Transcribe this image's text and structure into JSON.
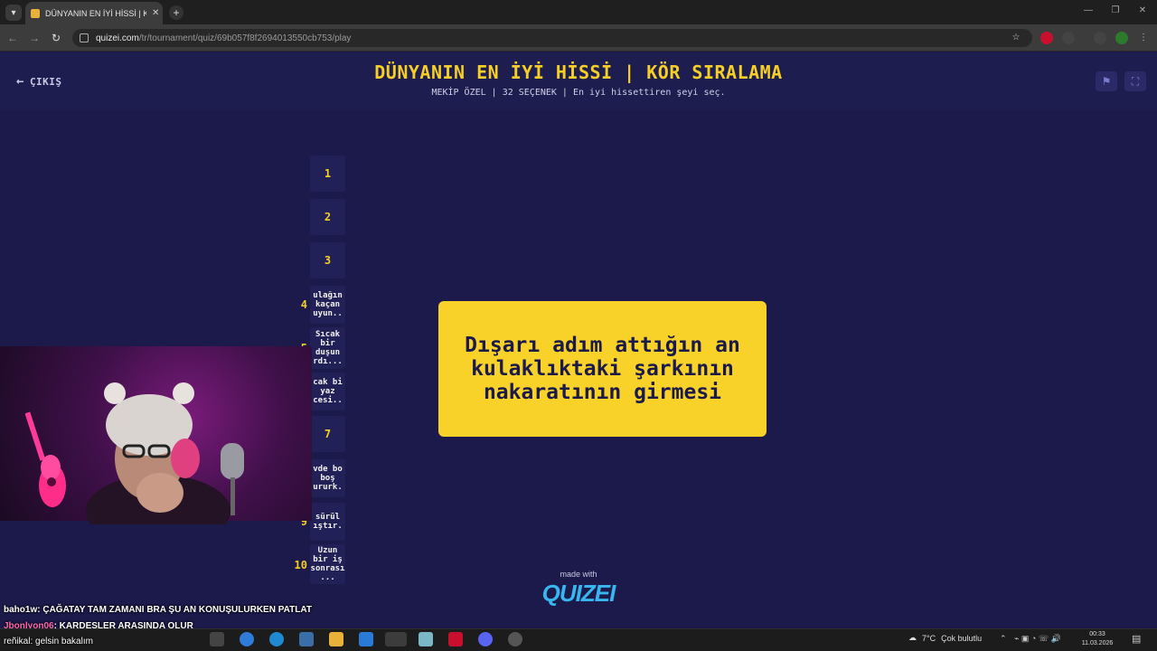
{
  "browser": {
    "tab_title": "DÜNYANIN EN İYİ HİSSİ | KÖR S",
    "url_domain": "quizei.com",
    "url_path": "/tr/tournament/quiz/69b057f8f2694013550cb753/play"
  },
  "header": {
    "exit_label": "ÇIKIŞ",
    "title": "DÜNYANIN EN İYİ HİSSİ | KÖR SIRALAMA",
    "subtitle": "MEKİP ÖZEL | 32 SEÇENEK | En iyi hissettiren şeyi seç."
  },
  "ranking": {
    "slots": [
      {
        "label": "1"
      },
      {
        "label": "2"
      },
      {
        "label": "3"
      },
      {
        "rank": "4",
        "text": "ulağın\nkaçan\nuyun.."
      },
      {
        "rank": "5",
        "text": "Sıcak\nbir\nduşun\nrdı..."
      },
      {
        "rank": "6",
        "text": "cak bi\nyaz\ncesi.."
      },
      {
        "label": "7"
      },
      {
        "rank": "8",
        "text": "vde bo\nboş\nururk."
      },
      {
        "rank": "9",
        "text": "sürül\nıştır."
      },
      {
        "rank": "10",
        "text": "Uzun\nbir iş\nsonrası\n..."
      }
    ]
  },
  "card": {
    "text": "Dışarı adım attığın an kulaklıktaki şarkının nakaratının girmesi"
  },
  "footer": {
    "made_with": "made with",
    "logo": "QUIZEI"
  },
  "chat": {
    "lines": [
      {
        "user": "baho1w",
        "message": ": ÇAĞATAY TAM ZAMANI BRA ŞU AN KONUŞULURKEN PATLAT"
      },
      {
        "user": "Jbonlyon06",
        "message": ": KARDEŞLER ARASINDA OLUR"
      },
      {
        "user": "reñikal",
        "message": ": gelsin bakalım"
      }
    ]
  },
  "taskbar": {
    "weather_temp": "7°C",
    "weather_text": "Çok bulutlu",
    "time": "00:33",
    "date": "11.03.2026"
  },
  "colors": {
    "accent": "#f6cf26",
    "page_bg": "#1b1a4a",
    "logo": "#38b6f0"
  }
}
